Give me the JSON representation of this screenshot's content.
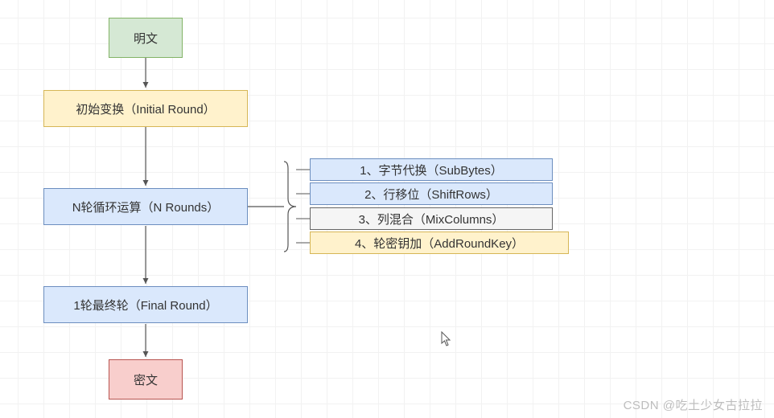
{
  "nodes": {
    "plaintext": "明文",
    "initial_round": "初始变换（Initial Round）",
    "n_rounds": "N轮循环运算（N Rounds）",
    "final_round": "1轮最终轮（Final Round）",
    "ciphertext": "密文"
  },
  "round_steps": [
    "1、字节代换（SubBytes）",
    "2、行移位（ShiftRows）",
    "3、列混合（MixColumns）",
    "4、轮密钥加（AddRoundKey）"
  ],
  "watermark": "CSDN @吃土少女古拉拉"
}
